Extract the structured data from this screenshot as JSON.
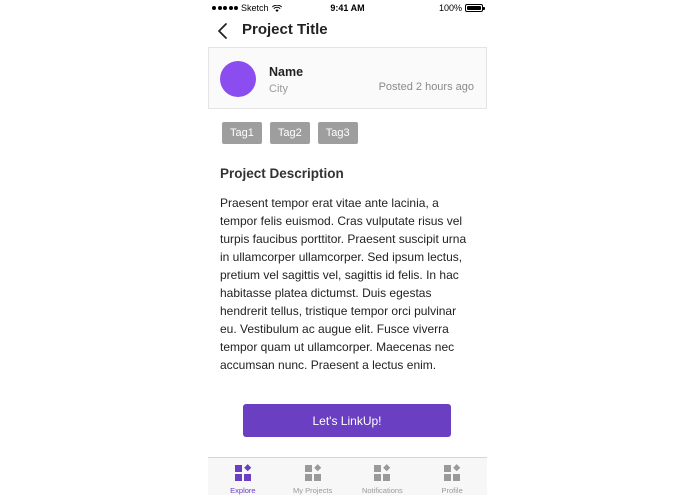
{
  "status_bar": {
    "carrier": "Sketch",
    "time": "9:41 AM",
    "battery": "100%"
  },
  "header": {
    "title": "Project Title",
    "back_icon": "chevron-left-icon"
  },
  "user": {
    "name": "Name",
    "city": "City",
    "posted": "Posted 2 hours ago",
    "avatar_color": "#8b4cf0"
  },
  "tags": [
    "Tag1",
    "Tag2",
    "Tag3"
  ],
  "description": {
    "heading": "Project Description",
    "body": "Praesent tempor erat vitae ante lacinia, a tempor felis euismod. Cras vulputate risus vel turpis faucibus porttitor. Praesent suscipit urna in ullamcorper ullamcorper. Sed ipsum lectus, pretium vel sagittis vel, sagittis id felis. In hac habitasse platea dictumst. Duis egestas hendrerit tellus, tristique tempor orci pulvinar eu. Vestibulum ac augue elit. Fusce viverra tempor quam ut ullamcorper. Maecenas nec accumsan nunc. Praesent a lectus enim."
  },
  "cta": {
    "label": "Let's LinkUp!"
  },
  "tabbar": {
    "tabs": [
      {
        "label": "Explore",
        "icon": "shapes-icon",
        "active": true
      },
      {
        "label": "My Projects",
        "icon": "shapes-icon",
        "active": false
      },
      {
        "label": "Notifications",
        "icon": "shapes-icon",
        "active": false
      },
      {
        "label": "Profile",
        "icon": "shapes-icon",
        "active": false
      }
    ]
  },
  "colors": {
    "accent": "#6a3fc1",
    "tag_bg": "#9e9e9e",
    "tab_inactive": "#9a9a9a"
  }
}
